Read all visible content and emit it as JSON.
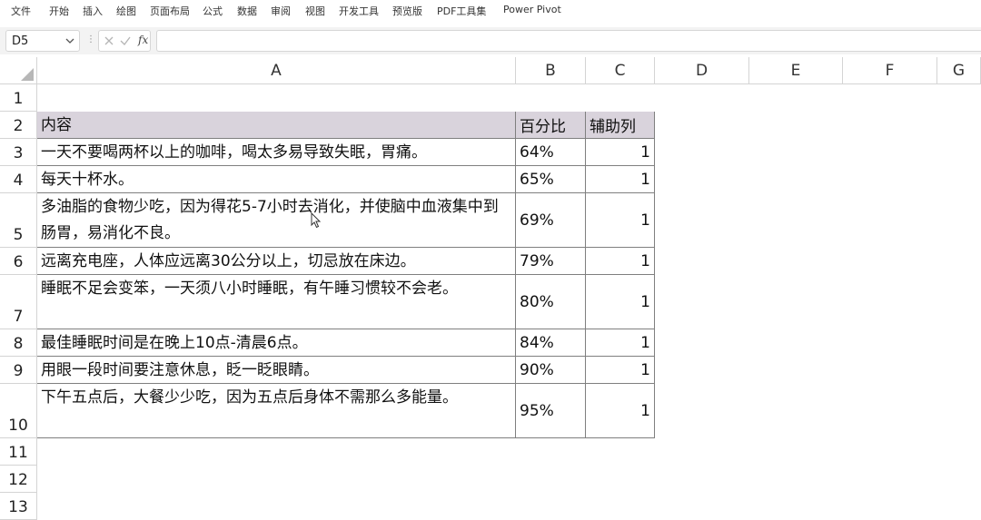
{
  "ribbon_tabs": [
    "文件",
    "开始",
    "插入",
    "绘图",
    "页面布局",
    "公式",
    "数据",
    "审阅",
    "视图",
    "开发工具",
    "预览版",
    "PDF工具集",
    "Power Pivot"
  ],
  "name_box": {
    "value": "D5"
  },
  "formula_bar": {
    "fx_label": "fx",
    "value": ""
  },
  "column_headers": [
    "A",
    "B",
    "C",
    "D",
    "E",
    "F",
    "G"
  ],
  "row_headers": [
    "1",
    "2",
    "3",
    "4",
    "5",
    "6",
    "7",
    "8",
    "9",
    "10",
    "11",
    "12",
    "13"
  ],
  "table": {
    "header": [
      "内容",
      "百分比",
      "辅助列"
    ],
    "rows": [
      [
        "一天不要喝两杯以上的咖啡，喝太多易导致失眠，胃痛。",
        "64%",
        "1"
      ],
      [
        "每天十杯水。",
        "65%",
        "1"
      ],
      [
        "多油脂的食物少吃，因为得花5-7小时去消化，并使脑中血液集中到肠胃，易消化不良。",
        "69%",
        "1"
      ],
      [
        "远离充电座，人体应远离30公分以上，切忌放在床边。",
        "79%",
        "1"
      ],
      [
        "睡眠不足会变笨，一天须八小时睡眠，有午睡习惯较不会老。",
        "80%",
        "1"
      ],
      [
        "最佳睡眠时间是在晚上10点-清晨6点。",
        "84%",
        "1"
      ],
      [
        "用眼一段时间要注意休息，眨一眨眼睛。",
        "90%",
        "1"
      ],
      [
        "下午五点后，大餐少少吃，因为五点后身体不需那么多能量。",
        "95%",
        "1"
      ]
    ]
  },
  "colors": {
    "header_fill": "#d9d3dc",
    "grid_line": "#d4d4d4",
    "cell_border": "#7f7f7f"
  }
}
